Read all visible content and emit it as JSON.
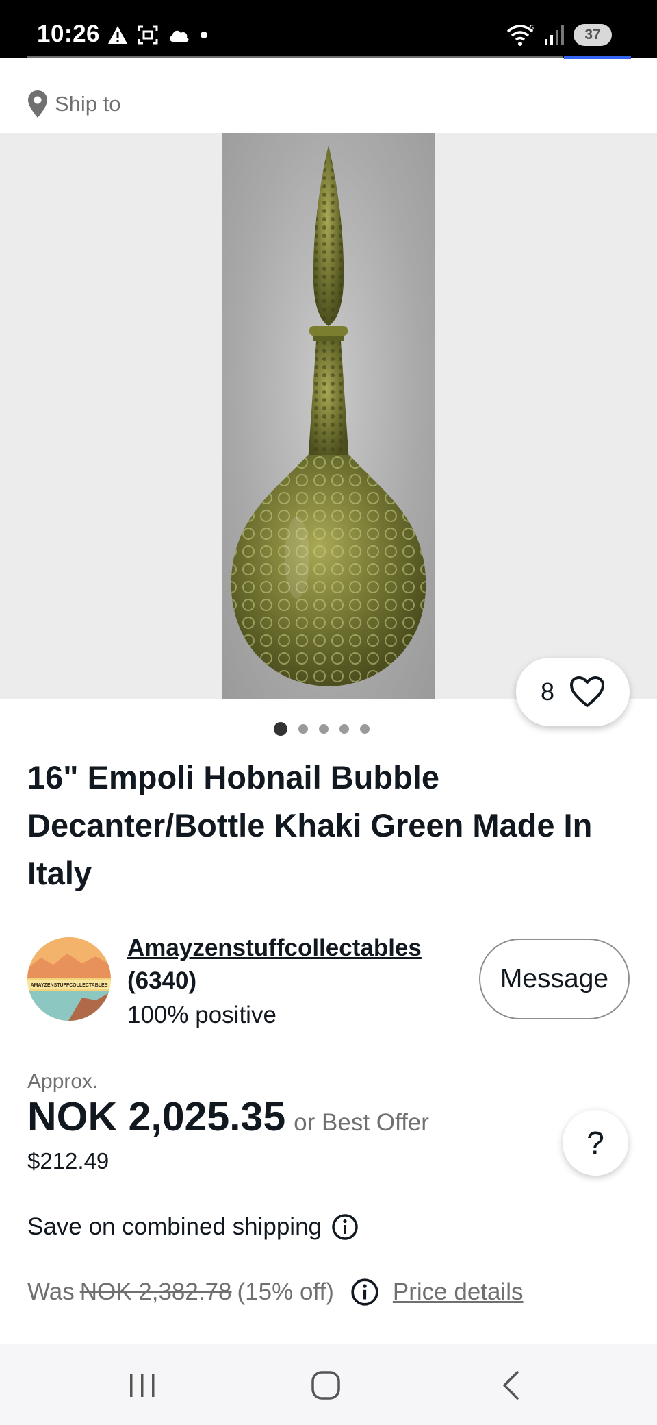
{
  "status_bar": {
    "time": "10:26",
    "left_icons": [
      "warning-icon",
      "screenshot-icon",
      "cloud-icon",
      "dot-icon"
    ],
    "right_icons": [
      "wifi-icon",
      "signal-icon"
    ],
    "wifi_label": "5",
    "battery": "37"
  },
  "ship_to": {
    "label": "Ship to",
    "icon": "location-pin-icon"
  },
  "gallery": {
    "watch_count": "8",
    "image_count": 5,
    "active_index": 0
  },
  "listing": {
    "title": "16\" Empoli Hobnail Bubble Decanter/Bottle Khaki Green Made In Italy"
  },
  "seller": {
    "name": "Amayzenstuffcollectables",
    "feedback_count": "(6340)",
    "positive": "100% positive",
    "avatar_text": "AMAYZENSTUFFCOLLECTABLES",
    "message_label": "Message"
  },
  "price": {
    "approx_label": "Approx.",
    "main": "NOK 2,025.35",
    "offer_label": "or Best Offer",
    "usd": "$212.49",
    "help_label": "?"
  },
  "shipping": {
    "combined_label": "Save on combined shipping"
  },
  "was": {
    "label": "Was",
    "old_price": "NOK 2,382.78",
    "discount": "(15% off)",
    "details_link": "Price details"
  },
  "colors": {
    "text": "#111820",
    "muted": "#707070",
    "accent": "#3665f3",
    "gallery_bg": "#ececec"
  }
}
